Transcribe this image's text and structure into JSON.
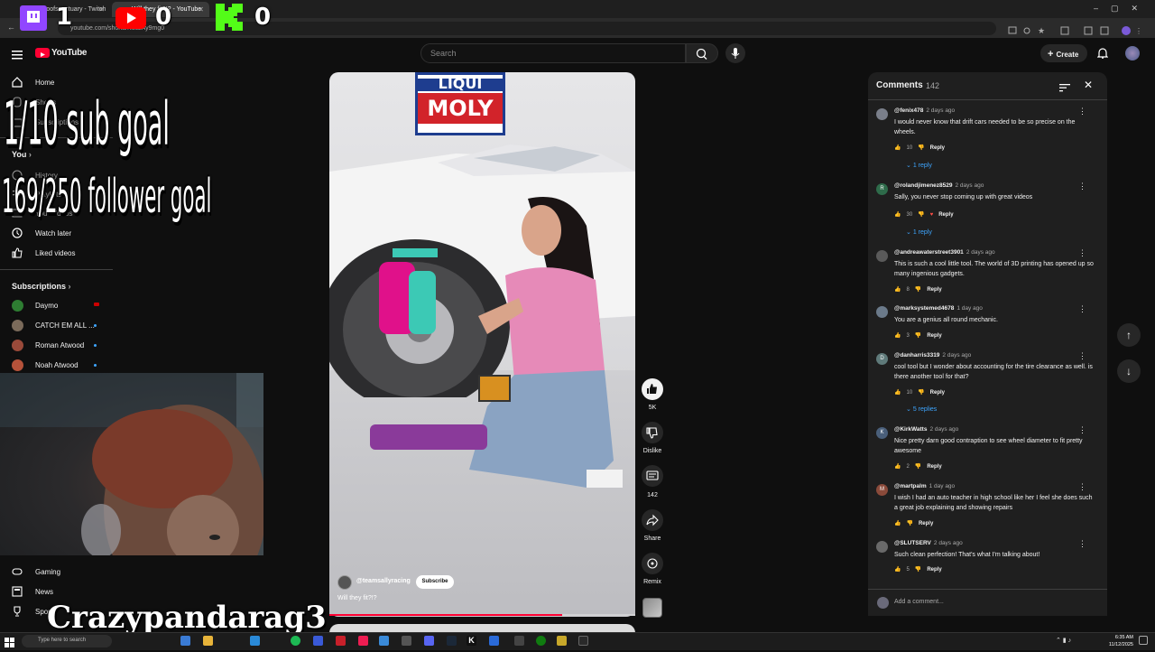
{
  "browser": {
    "tabs": [
      {
        "label": "ceoofsanctuary - Twitch",
        "active": false
      },
      {
        "label": "Will they fit?!? - YouTube",
        "active": true
      }
    ],
    "url": "youtube.com/shorts/KuczAy9mg0"
  },
  "overlay": {
    "counters": [
      {
        "platform": "twitch-icon",
        "value": "1"
      },
      {
        "platform": "youtube-icon",
        "value": "0"
      },
      {
        "platform": "kick-icon",
        "value": "0"
      }
    ],
    "sub_goal": "1/10 sub goal",
    "follower_goal": "169/250 follower goal",
    "streamer_name": "Crazypandarag3"
  },
  "header": {
    "logo_text": "YouTube",
    "search_placeholder": "Search",
    "create_label": "Create"
  },
  "sidebar": {
    "home": "Home",
    "shorts": "Shorts",
    "subscriptions_link": "Subscriptions",
    "you": "You",
    "history": "History",
    "playlists": "Playlists",
    "your_videos": "Your videos",
    "watch_later": "Watch later",
    "liked_videos": "Liked videos",
    "subscriptions_heading": "Subscriptions",
    "subscriptions": [
      {
        "name": "Daymo",
        "avatar_color": "#2e7d32",
        "status": "live"
      },
      {
        "name": "CATCH EM ALL ...",
        "avatar_color": "#7a6a5a",
        "status": "new"
      },
      {
        "name": "Roman Atwood",
        "avatar_color": "#9a4a3a",
        "status": "new"
      },
      {
        "name": "Noah Atwood",
        "avatar_color": "#b5523a",
        "status": "new"
      }
    ],
    "gaming": "Gaming",
    "news": "News",
    "sports": "Sports"
  },
  "video": {
    "sponsor_top": "LIQUI",
    "sponsor_brand": "MOLY",
    "channel": "@teamsallyracing",
    "subscribe_label": "Subscribe",
    "title": "Will they fit?!?",
    "progress": 0.76
  },
  "actions": {
    "likes": "5K",
    "dislike": "Dislike",
    "comments": "142",
    "share": "Share",
    "remix": "Remix"
  },
  "comments": {
    "title": "Comments",
    "count": "142",
    "add_placeholder": "Add a comment...",
    "items": [
      {
        "user": "@fenix478",
        "time": "2 days ago",
        "text": "I would never know that drift cars needed to be so precise on the wheels.",
        "likes": "10",
        "replies": "1 reply",
        "avatar": "",
        "avatar_color": "#7a7f8a"
      },
      {
        "user": "@rolandjimenez8529",
        "time": "2 days ago",
        "text": "Sally, you never stop coming up with great videos",
        "likes": "30",
        "replies": "1 reply",
        "avatar": "R",
        "avatar_color": "#2e6b4a"
      },
      {
        "user": "@andreawaterstreet3901",
        "time": "2 days ago",
        "text": "This is such a cool little tool. The world of 3D printing has opened up so many ingenious gadgets.",
        "likes": "8",
        "replies": "",
        "avatar": "",
        "avatar_color": "#5a5a5a"
      },
      {
        "user": "@marksystemed4678",
        "time": "1 day ago",
        "text": "You are a genius all round mechanic.",
        "likes": "3",
        "replies": "",
        "avatar": "",
        "avatar_color": "#6b7a8a"
      },
      {
        "user": "@danharris3319",
        "time": "2 days ago",
        "text": "cool tool but I wonder about accounting for the tire clearance as well. is there another tool for that?",
        "likes": "10",
        "replies": "5 replies",
        "avatar": "D",
        "avatar_color": "#5f7a7a"
      },
      {
        "user": "@KirkWatts",
        "time": "2 days ago",
        "text": "Nice pretty darn good contraption to see wheel diameter to fit pretty awesome",
        "likes": "2",
        "replies": "",
        "avatar": "K",
        "avatar_color": "#4a5f7a"
      },
      {
        "user": "@martpalm",
        "time": "1 day ago",
        "text": "I wish I had an auto teacher in high school like her I feel she does such a great job explaining and showing repairs",
        "likes": "",
        "replies": "",
        "avatar": "M",
        "avatar_color": "#8a4a3a"
      },
      {
        "user": "@SLUTSERV",
        "time": "2 days ago",
        "text": "Such clean perfection! That's what I'm talking about!",
        "likes": "5",
        "replies": "",
        "avatar": "",
        "avatar_color": "#6a6a6a"
      }
    ],
    "reply_label": "Reply"
  },
  "taskbar": {
    "search_placeholder": "Type here to search",
    "time": "6:35 AM",
    "date": "11/12/2025"
  },
  "colors": {
    "youtube_red": "#ff0033",
    "twitch_purple": "#9146ff",
    "kick_green": "#53fc18",
    "link_blue": "#3ea6ff"
  }
}
